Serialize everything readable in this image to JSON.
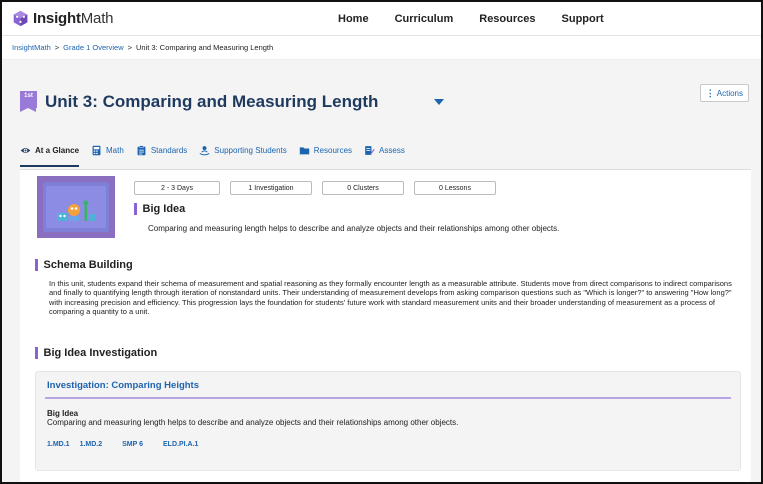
{
  "brand": {
    "name_bold": "Insight",
    "name_rest": "Math"
  },
  "nav": {
    "items": [
      "Home",
      "Curriculum",
      "Resources",
      "Support"
    ]
  },
  "breadcrumb": {
    "items": [
      "InsightMath",
      "Grade 1 Overview",
      "Unit 3: Comparing and Measuring Length"
    ],
    "separator": ">"
  },
  "unit": {
    "grade_badge": "1st",
    "title": "Unit 3: Comparing and Measuring Length",
    "actions_label": "Actions"
  },
  "tabs": [
    {
      "label": "At a Glance",
      "icon": "eye-icon",
      "active": true
    },
    {
      "label": "Math",
      "icon": "calculator-icon"
    },
    {
      "label": "Standards",
      "icon": "clipboard-icon"
    },
    {
      "label": "Supporting Students",
      "icon": "person-hands-icon"
    },
    {
      "label": "Resources",
      "icon": "folder-icon"
    },
    {
      "label": "Assess",
      "icon": "assessment-icon"
    }
  ],
  "summary": {
    "days": "2 - 3 Days",
    "investigations": "1 Investigation",
    "clusters": "0 Clusters",
    "lessons": "0 Lessons"
  },
  "big_idea": {
    "heading": "Big Idea",
    "text": "Comparing and measuring length helps to describe and analyze objects and their relationships among other objects."
  },
  "schema": {
    "heading": "Schema Building",
    "text": "In this unit, students expand their schema of measurement and spatial reasoning as they formally encounter length as a measurable attribute. Students move from direct comparisons to indirect comparisons and finally to quantifying length through iteration of nonstandard units. Their understanding of measurement develops from asking comparison questions such as  \"Which is longer?\" to answering \"How long?\" with increasing precision and efficiency. This progression lays the foundation for students' future work with standard measurement units and their broader understanding of measurement as a process of comparing a quantity to a unit."
  },
  "investigation_section": {
    "heading": "Big Idea Investigation",
    "card_title": "Investigation: Comparing Heights",
    "big_idea_heading": "Big Idea",
    "big_idea_text": "Comparing and measuring length helps to describe and analyze objects and their relationships among other objects.",
    "standards": [
      "1.MD.1",
      "1.MD.2",
      "SMP 6",
      "ELD.PI.A.1"
    ]
  },
  "colors": {
    "accent_purple": "#8a63d2",
    "link_blue": "#1d64b0",
    "title_navy": "#1f3a5f"
  }
}
